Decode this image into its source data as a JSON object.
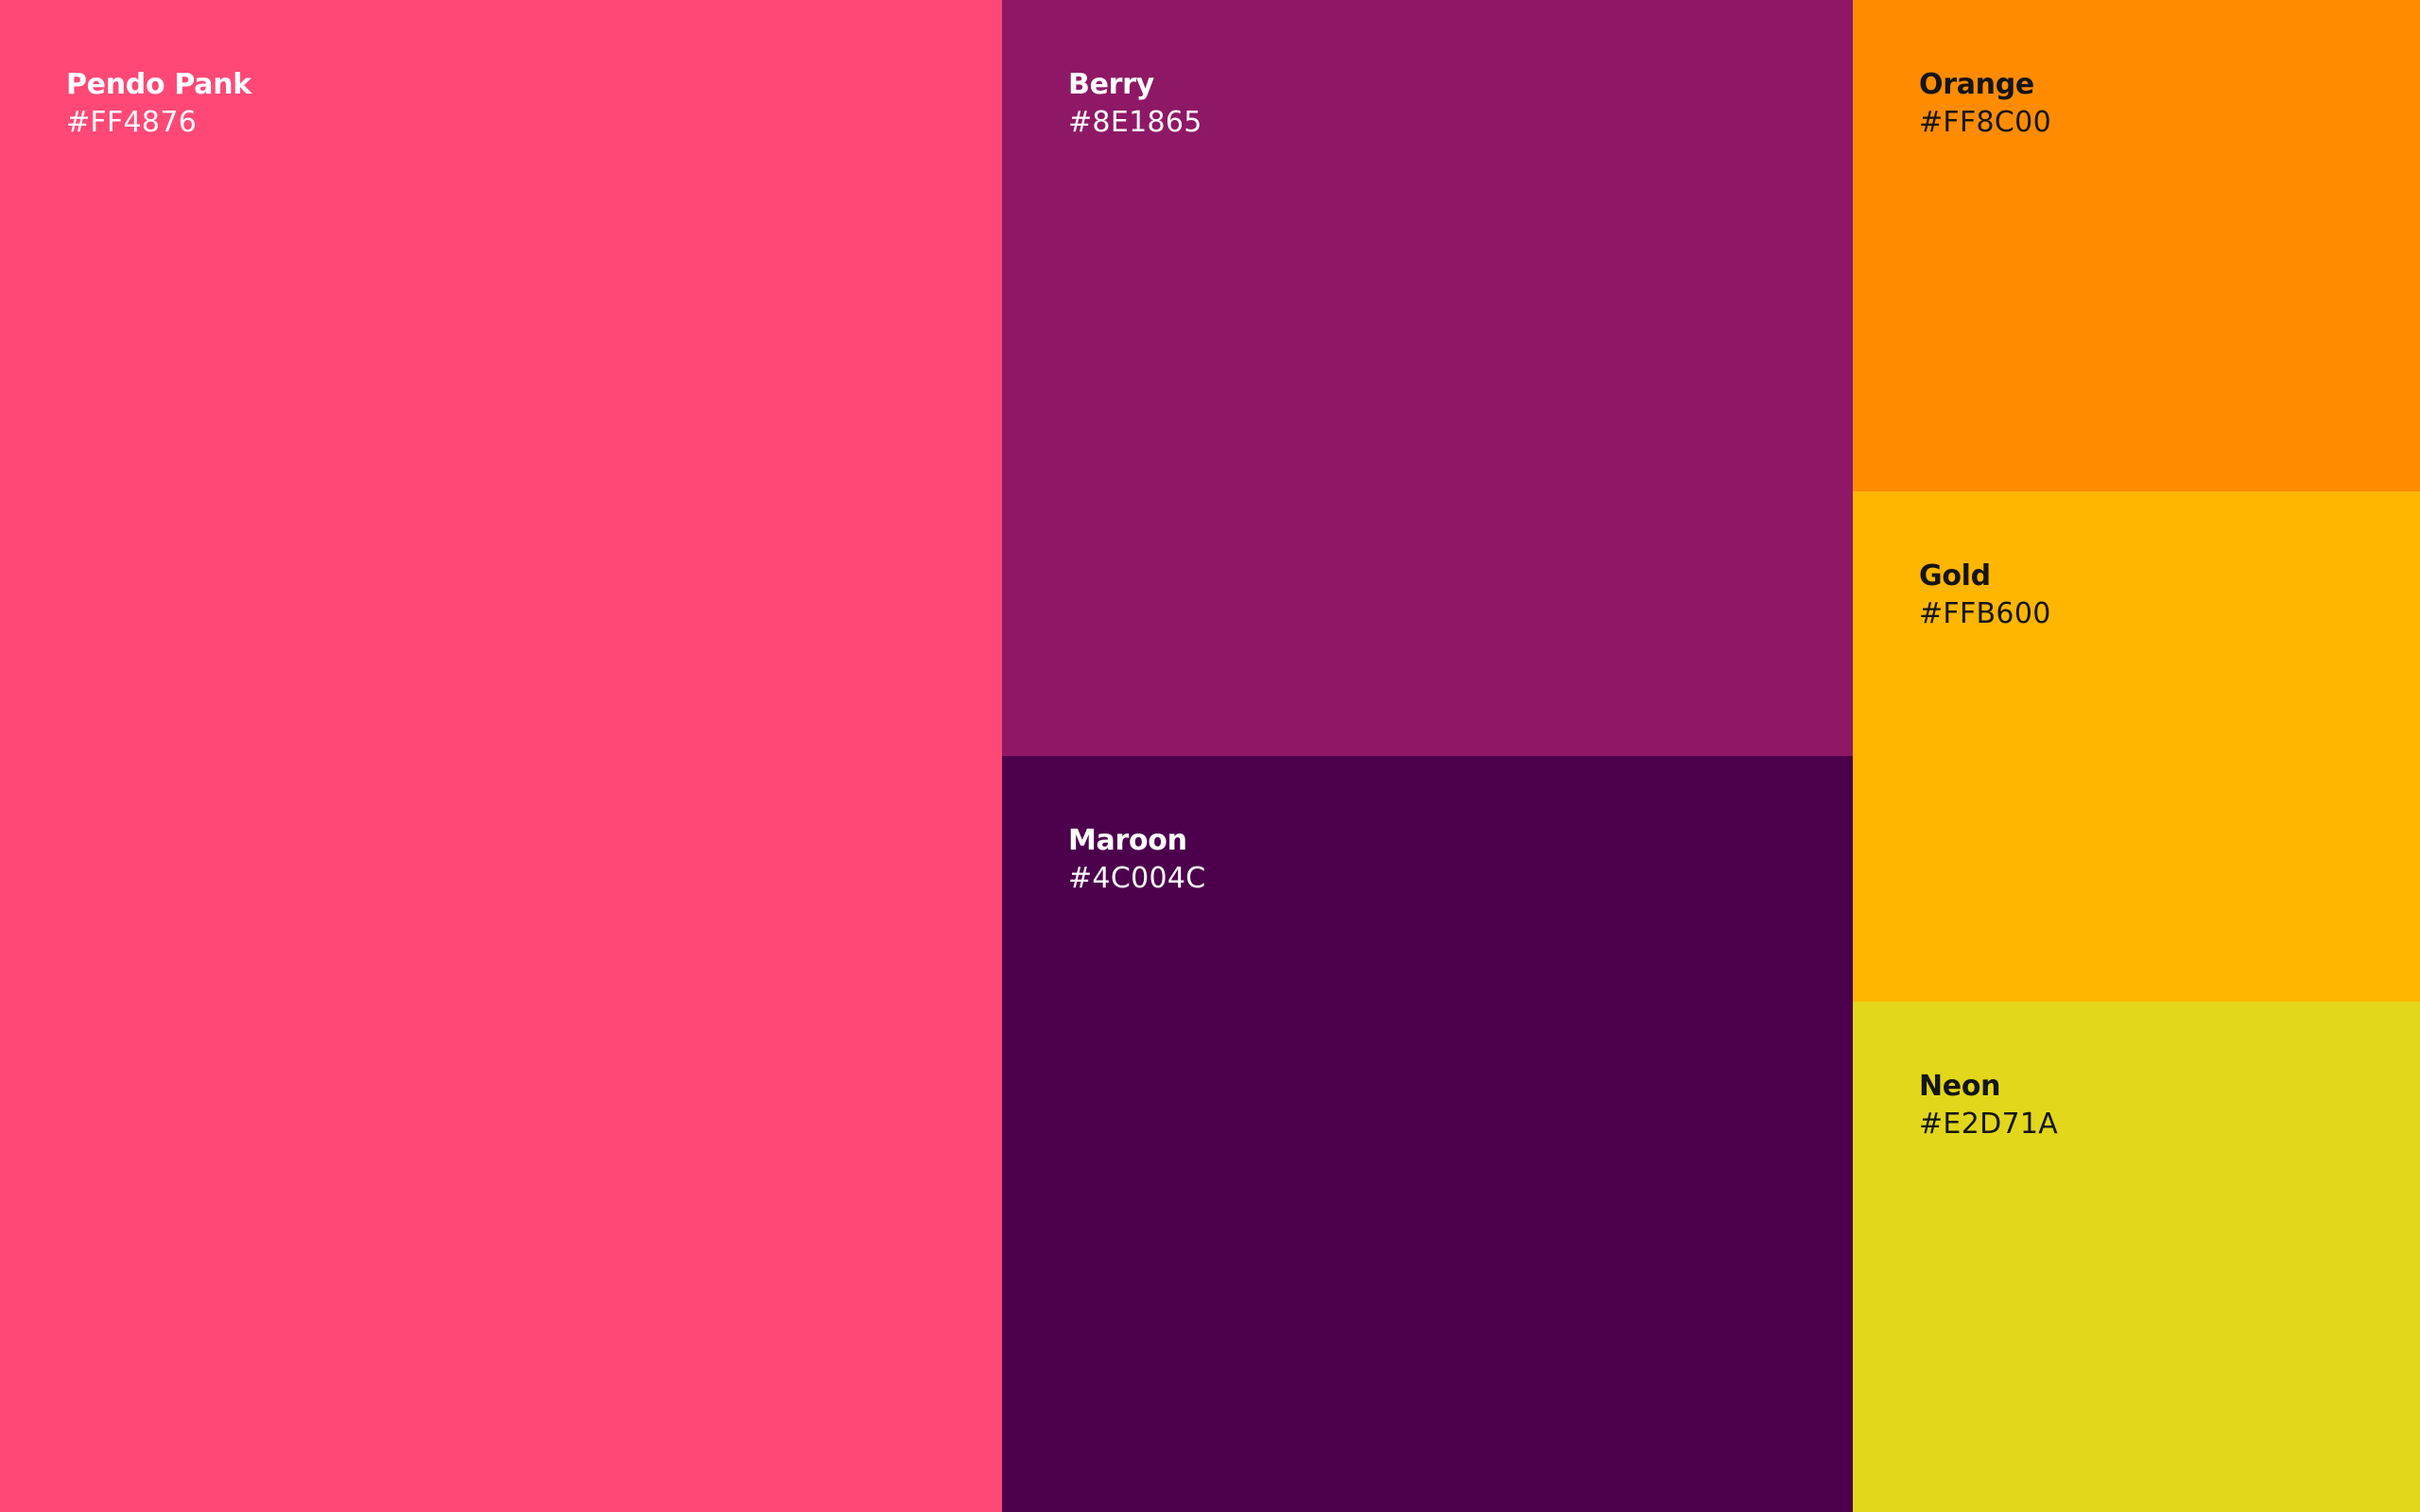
{
  "swatches": [
    {
      "name": "Pendo Pank",
      "hex": "#FF4876",
      "color": "#FF4876",
      "text_color": "#FFFFFF"
    },
    {
      "name": "Berry",
      "hex": "#8E1865",
      "color": "#8E1865",
      "text_color": "#FFFFFF"
    },
    {
      "name": "Maroon",
      "hex": "#4C004C",
      "color": "#4C004C",
      "text_color": "#FFFFFF"
    },
    {
      "name": "Orange",
      "hex": "#FF8C00",
      "color": "#FF8C00",
      "text_color": "#141414"
    },
    {
      "name": "Gold",
      "hex": "#FFB600",
      "color": "#FFB600",
      "text_color": "#141414"
    },
    {
      "name": "Neon",
      "hex": "#E2D71A",
      "color": "#E2D71A",
      "text_color": "#141414"
    }
  ]
}
